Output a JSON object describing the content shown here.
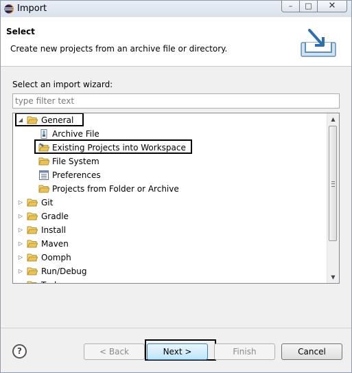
{
  "window": {
    "title": "Import",
    "controls": {
      "minimize": "–",
      "maximize": "□",
      "close": "✕"
    }
  },
  "header": {
    "title": "Select",
    "description": "Create new projects from an archive file or directory.",
    "image_icon": "import-wizard-banner-icon"
  },
  "wizard": {
    "label": "Select an import wizard:",
    "filter_placeholder": "type filter text",
    "filter_value": ""
  },
  "tree": {
    "general": {
      "label": "General",
      "expanded": true
    },
    "general_children": [
      {
        "label": "Archive File",
        "icon": "archive-file-icon"
      },
      {
        "label": "Existing Projects into Workspace",
        "icon": "projects-folder-icon",
        "selected": true
      },
      {
        "label": "File System",
        "icon": "folder-icon"
      },
      {
        "label": "Preferences",
        "icon": "preferences-icon"
      },
      {
        "label": "Projects from Folder or Archive",
        "icon": "folder-icon"
      }
    ],
    "categories": [
      {
        "label": "Git"
      },
      {
        "label": "Gradle"
      },
      {
        "label": "Install"
      },
      {
        "label": "Maven"
      },
      {
        "label": "Oomph"
      },
      {
        "label": "Run/Debug"
      },
      {
        "label": "Tasks"
      }
    ]
  },
  "buttons": {
    "help": "?",
    "back": "< Back",
    "next": "Next >",
    "finish": "Finish",
    "cancel": "Cancel"
  },
  "colors": {
    "folder": "#e8c25a",
    "selection_highlight": "#000000",
    "next_button": "#bee6fd"
  }
}
